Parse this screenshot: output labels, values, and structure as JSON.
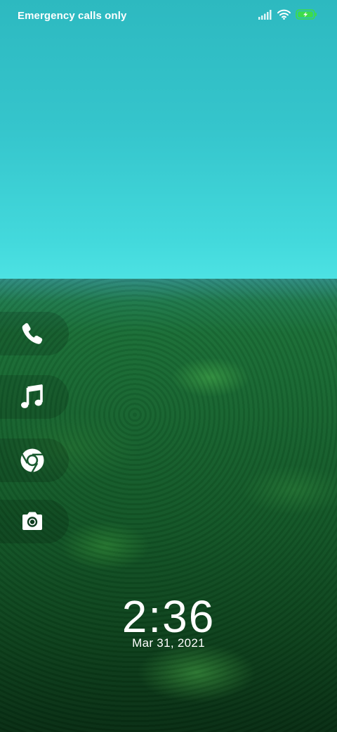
{
  "status_bar": {
    "carrier": "Emergency calls only",
    "icons": [
      "signal-icon",
      "wifi-icon",
      "battery-charging-icon"
    ],
    "battery_color": "#3ddc4a"
  },
  "shortcuts": [
    {
      "name": "phone-icon"
    },
    {
      "name": "music-icon"
    },
    {
      "name": "chrome-icon"
    },
    {
      "name": "camera-icon"
    }
  ],
  "lockscreen": {
    "time": "2:36",
    "date": "Mar 31, 2021"
  }
}
